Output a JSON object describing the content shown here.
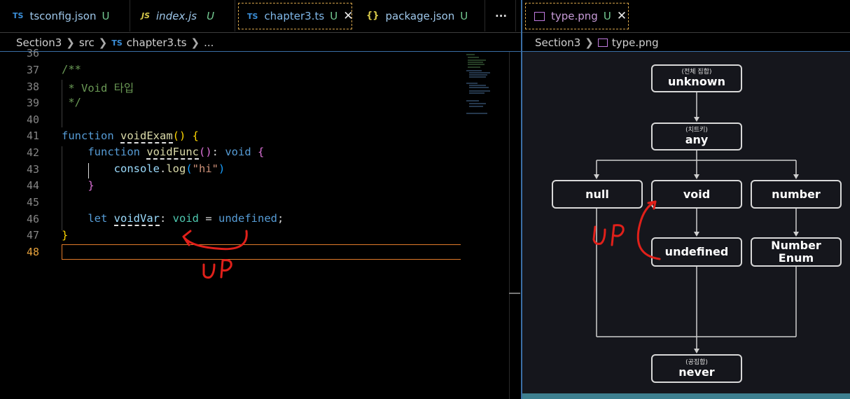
{
  "left_tabs": [
    {
      "icon": "TS",
      "label": "tsconfig.json",
      "mod": "U"
    },
    {
      "icon": "JS",
      "label": "index.js",
      "mod": "U"
    },
    {
      "icon": "TS",
      "label": "chapter3.ts",
      "mod": "U",
      "close": "✕"
    },
    {
      "icon": "{}",
      "label": "package.json",
      "mod": "U"
    }
  ],
  "more_tabs": "···",
  "right_tab": {
    "label": "type.png",
    "mod": "U",
    "close": "✕"
  },
  "left_breadcrumb": [
    "Section3",
    "src",
    "chapter3.ts",
    "..."
  ],
  "right_breadcrumb": [
    "Section3",
    "type.png"
  ],
  "line_numbers": [
    "36",
    "37",
    "38",
    "39",
    "40",
    "41",
    "42",
    "43",
    "44",
    "45",
    "46",
    "47",
    "48"
  ],
  "code": {
    "l37": "/**",
    "l38": " * Void 타입",
    "l39": " */",
    "kw_function": "function",
    "fn_voidExam": "voidExam",
    "fn_voidFunc": "voidFunc",
    "kw_void": "void",
    "console": "console",
    "log": "log",
    "str_hi": "\"hi\"",
    "kw_let": "let",
    "var_voidVar": "voidVar",
    "kw_undefined": "undefined"
  },
  "annotation_text": "UP",
  "diagram": {
    "unknown": {
      "sub": "(전체 집합)",
      "main": "unknown"
    },
    "any": {
      "sub": "(치트키)",
      "main": "any"
    },
    "null": {
      "main": "null"
    },
    "void": {
      "main": "void"
    },
    "number": {
      "main": "number"
    },
    "undefined": {
      "main": "undefined"
    },
    "number_enum": {
      "main": "Number Enum"
    },
    "never": {
      "sub": "(공집합)",
      "main": "never"
    }
  },
  "colors": {
    "annotation": "#e0201a",
    "accent_border": "#3a6ea5",
    "current_line": "#e07a2a"
  }
}
